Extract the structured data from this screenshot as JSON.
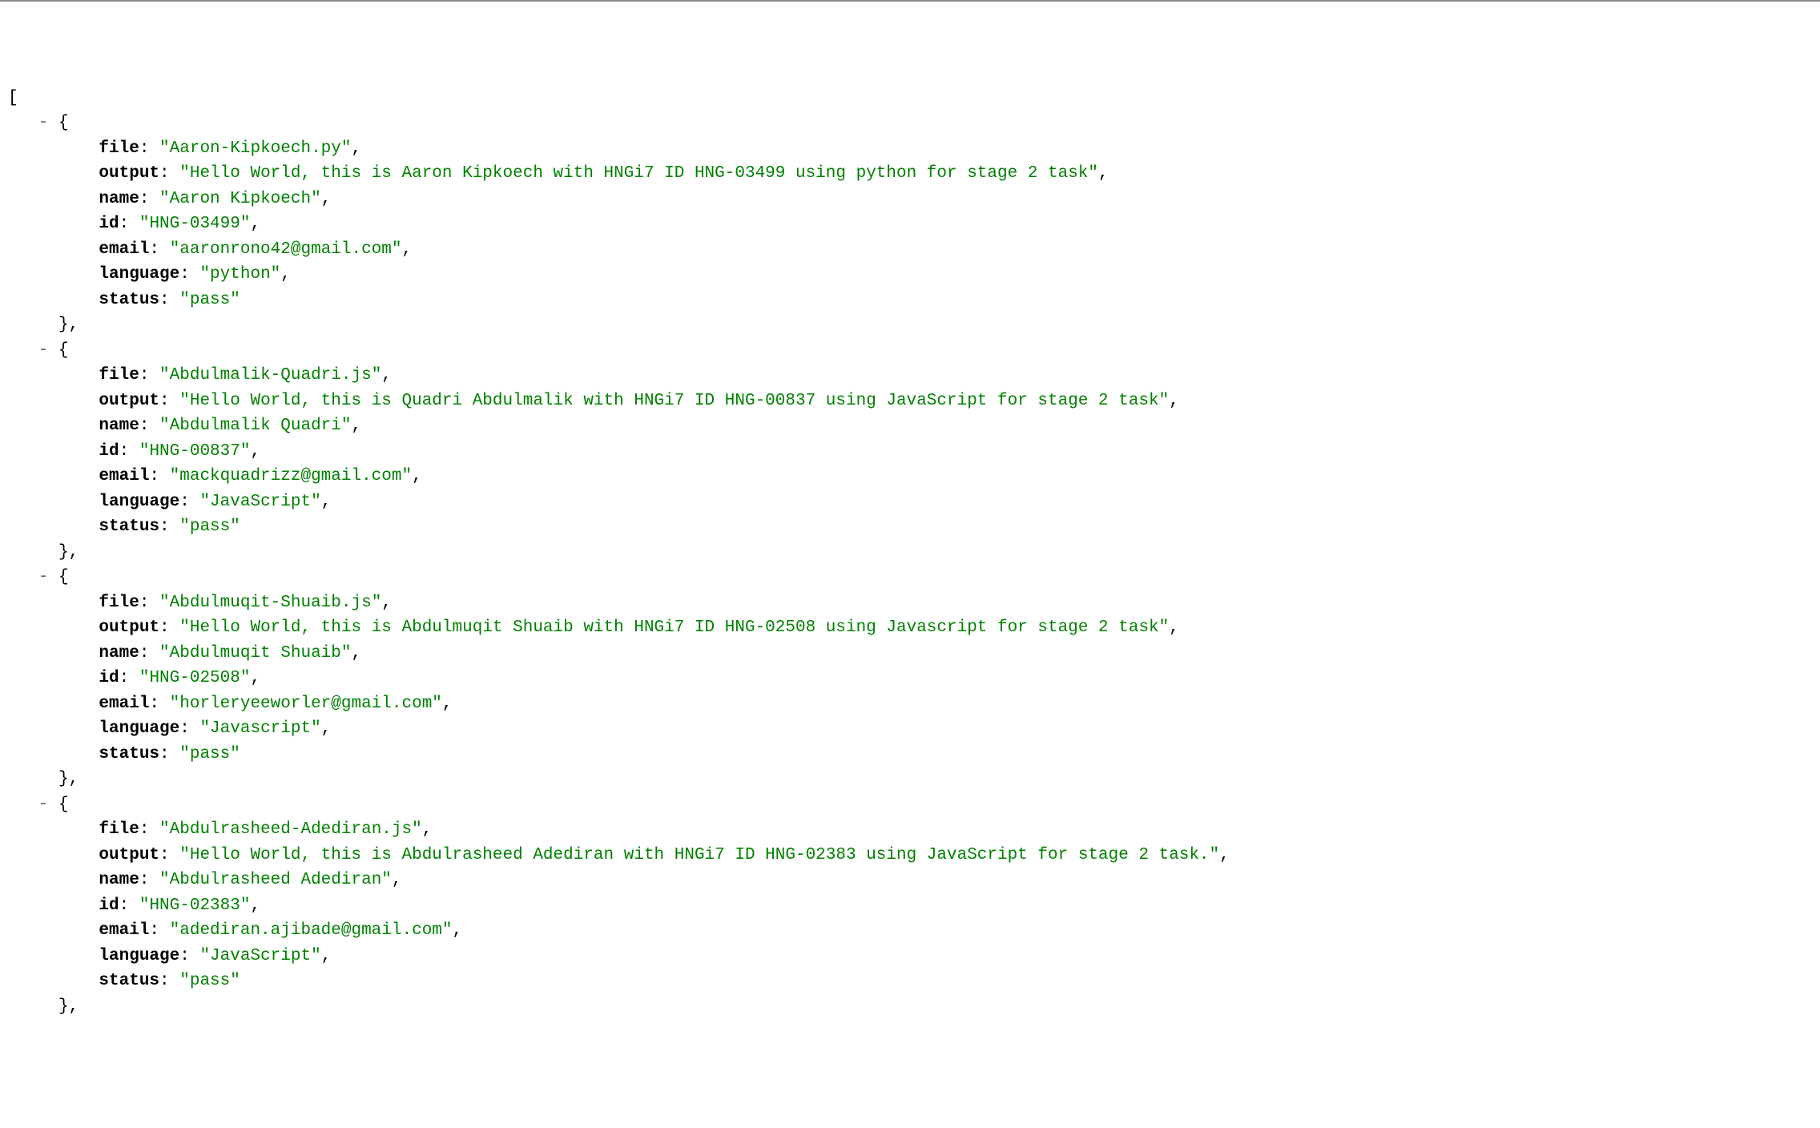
{
  "toggle": "-",
  "open_bracket": "[",
  "open_brace": "{",
  "close_brace_comma": "},",
  "entries": [
    {
      "file": "\"Aaron-Kipkoech.py\"",
      "output": "\"Hello World, this is Aaron Kipkoech with HNGi7 ID HNG-03499 using python for stage 2 task\"",
      "name": "\"Aaron Kipkoech\"",
      "id": "\"HNG-03499\"",
      "email": "\"aaronrono42@gmail.com\"",
      "language": "\"python\"",
      "status": "\"pass\""
    },
    {
      "file": "\"Abdulmalik-Quadri.js\"",
      "output": "\"Hello World, this is Quadri Abdulmalik with HNGi7 ID HNG-00837 using JavaScript for stage 2 task\"",
      "name": "\"Abdulmalik Quadri\"",
      "id": "\"HNG-00837\"",
      "email": "\"mackquadrizz@gmail.com\"",
      "language": "\"JavaScript\"",
      "status": "\"pass\""
    },
    {
      "file": "\"Abdulmuqit-Shuaib.js\"",
      "output": "\"Hello World, this is Abdulmuqit Shuaib with HNGi7 ID HNG-02508 using Javascript for stage 2 task\"",
      "name": "\"Abdulmuqit Shuaib\"",
      "id": "\"HNG-02508\"",
      "email": "\"horleryeeworler@gmail.com\"",
      "language": "\"Javascript\"",
      "status": "\"pass\""
    },
    {
      "file": "\"Abdulrasheed-Adediran.js\"",
      "output": "\"Hello World, this is Abdulrasheed Adediran with HNGi7 ID HNG-02383 using JavaScript for stage 2 task.\"",
      "name": "\"Abdulrasheed Adediran\"",
      "id": "\"HNG-02383\"",
      "email": "\"adediran.ajibade@gmail.com\"",
      "language": "\"JavaScript\"",
      "status": "\"pass\""
    }
  ],
  "labels": {
    "file": "file",
    "output": "output",
    "name": "name",
    "id": "id",
    "email": "email",
    "language": "language",
    "status": "status"
  }
}
